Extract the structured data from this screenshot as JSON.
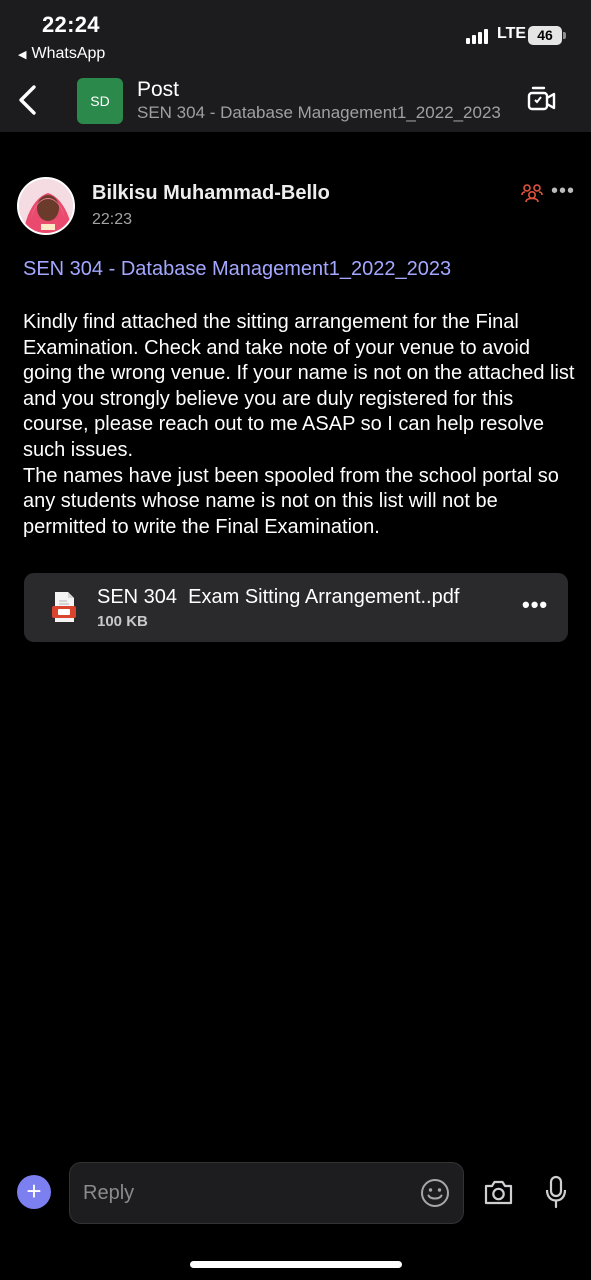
{
  "status_bar": {
    "time": "22:24",
    "back_app": "WhatsApp",
    "network": "LTE",
    "battery": "46"
  },
  "header": {
    "channel_initials": "SD",
    "title": "Post",
    "subtitle": "SEN 304 - Database Management1_2022_2023"
  },
  "post": {
    "author": "Bilkisu Muhammad-Bello",
    "time": "22:23",
    "subject": "SEN 304 - Database Management1_2022_2023",
    "body": "Kindly find attached the sitting arrangement for the Final Examination. Check and take note of your venue to avoid going the wrong venue. If your name is not on the attached list and you strongly believe you are duly registered for this course, please reach out to me ASAP so I can help resolve such issues.\nThe names have just been spooled from the school portal so any students whose name is not on this list will not be permitted to write the Final Examination.",
    "attachment": {
      "name": "SEN 304  Exam Sitting Arrangement..pdf",
      "size": "100 KB"
    }
  },
  "composer": {
    "placeholder": "Reply"
  },
  "colors": {
    "accent": "#7b7ff0",
    "link": "#a4a7ff",
    "channel_avatar": "#2b8a4b",
    "pdf_red": "#d9442f"
  },
  "icons": [
    "chevron-left-icon",
    "meet-now-icon",
    "reactions-icon",
    "more-icon",
    "pdf-file-icon",
    "plus-icon",
    "emoji-icon",
    "camera-icon",
    "microphone-icon"
  ]
}
